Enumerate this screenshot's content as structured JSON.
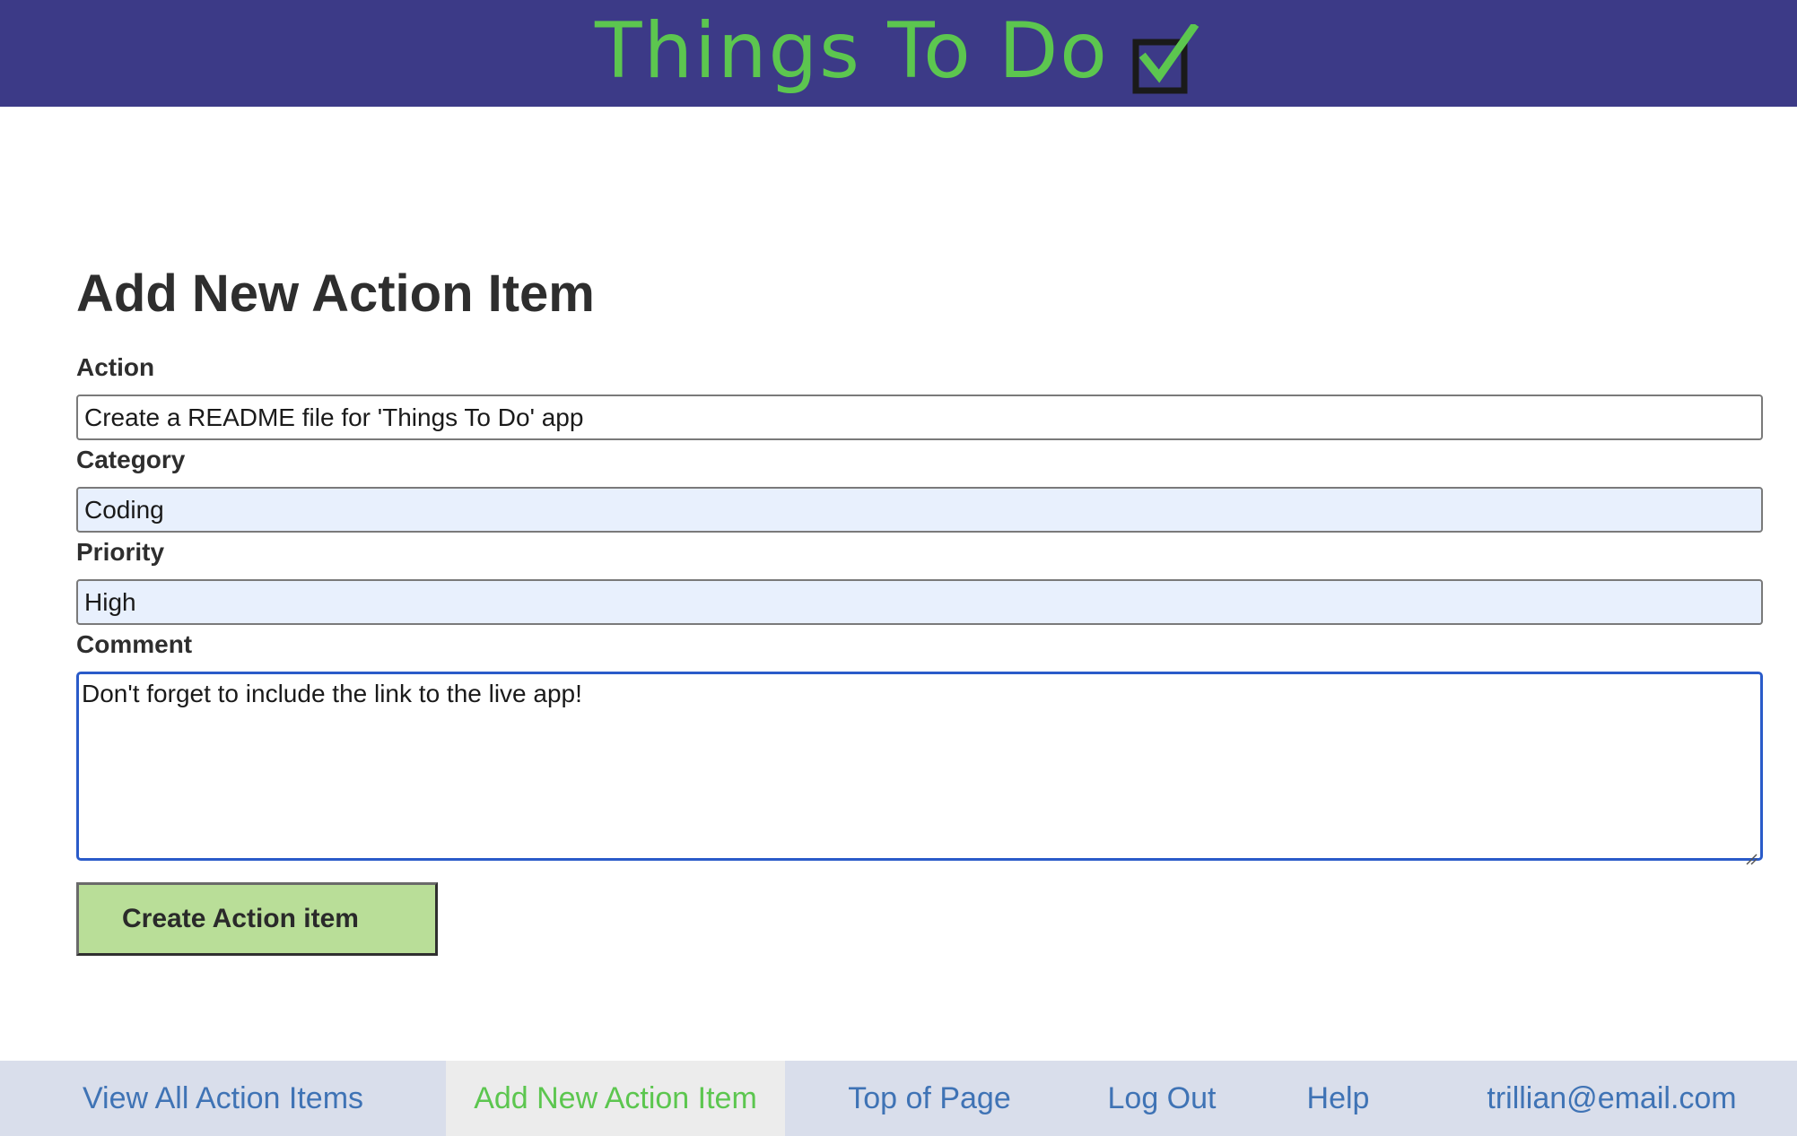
{
  "header": {
    "title": "Things To Do",
    "logo_icon": "checkbox-checked-icon",
    "background_color": "#3c3a87",
    "title_color": "#5cc64f"
  },
  "form": {
    "heading": "Add New Action Item",
    "action": {
      "label": "Action",
      "value": "Create a README file for 'Things To Do' app"
    },
    "category": {
      "label": "Category",
      "value": "Coding"
    },
    "priority": {
      "label": "Priority",
      "value": "High"
    },
    "comment": {
      "label": "Comment",
      "value": "Don't forget to include the link to the live app!"
    },
    "submit_label": "Create Action item",
    "submit_color": "#b9de98"
  },
  "footer": {
    "background_color": "#d9deeb",
    "link_color": "#3f73b5",
    "active_color": "#5cc64f",
    "items": [
      {
        "label": "View All Action Items",
        "active": false
      },
      {
        "label": "Add New Action Item",
        "active": true
      },
      {
        "label": "Top of Page",
        "active": false
      },
      {
        "label": "Log Out",
        "active": false
      },
      {
        "label": "Help",
        "active": false
      },
      {
        "label": "trillian@email.com",
        "active": false
      }
    ]
  }
}
